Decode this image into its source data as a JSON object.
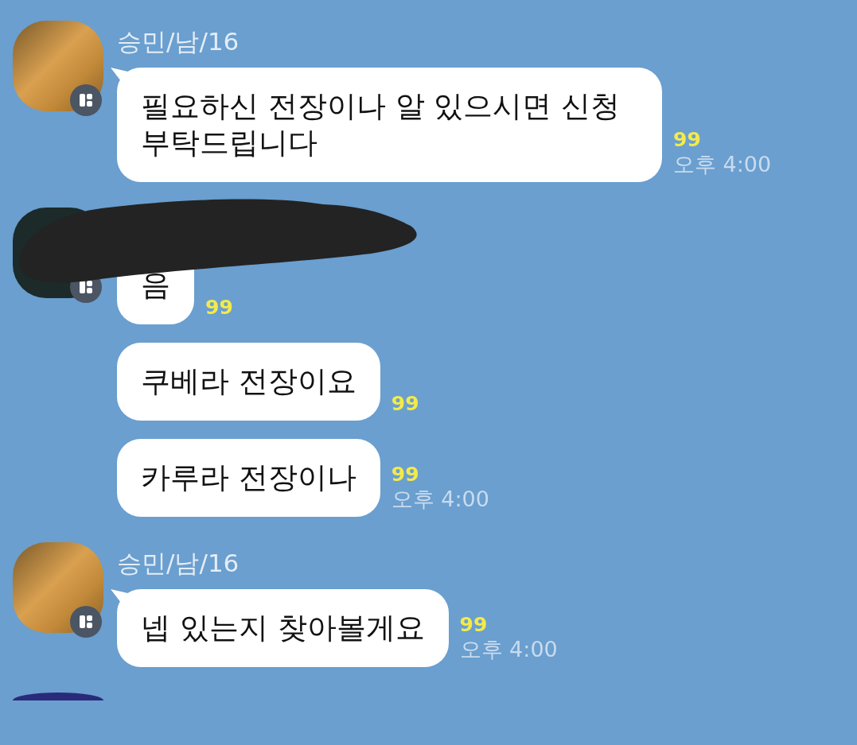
{
  "groups": [
    {
      "sender": "승민/남/16",
      "kind": "photo",
      "redacted": false,
      "messages": [
        {
          "text": "필요하신 전장이나 알 있으시면 신청 부탁드립니다",
          "unread": "99",
          "time": "오후 4:00"
        }
      ]
    },
    {
      "kind": "dark",
      "redacted": true,
      "messages": [
        {
          "text": "음",
          "unread": "99"
        },
        {
          "text": "쿠베라 전장이요",
          "unread": "99"
        },
        {
          "text": "카루라 전장이나",
          "unread": "99",
          "time": "오후 4:00"
        }
      ]
    },
    {
      "sender": "승민/남/16",
      "kind": "photo",
      "redacted": false,
      "messages": [
        {
          "text": "넵 있는지 찾아볼게요",
          "unread": "99",
          "time": "오후 4:00"
        }
      ]
    },
    {
      "kind": "round",
      "redacted": false
    }
  ]
}
